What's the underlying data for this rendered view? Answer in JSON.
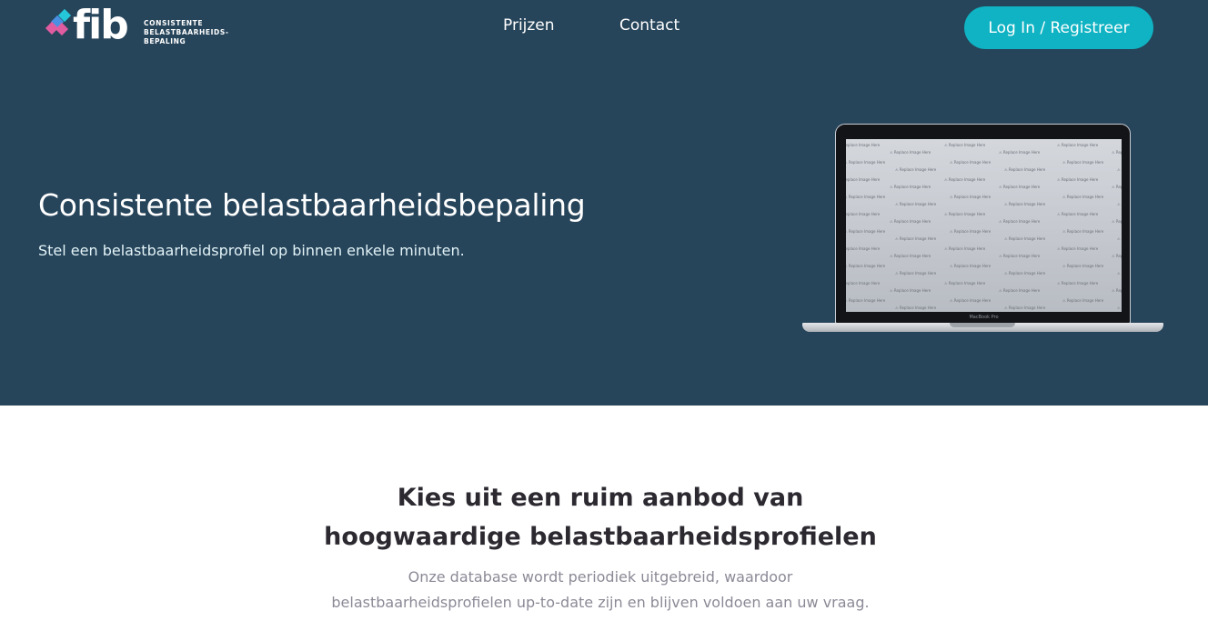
{
  "brand": {
    "logo_text": "fib",
    "tagline_lines": [
      "CONSISTENTE",
      "BELASTBAARHEIDS-",
      "BEPALING"
    ],
    "colors": {
      "pink": "#e05ca0",
      "cyan": "#26c6da",
      "blue": "#4a90e2"
    }
  },
  "nav": {
    "links": [
      "Prijzen",
      "Contact"
    ],
    "login_label": "Log In / Registreer"
  },
  "hero": {
    "title": "Consistente belastbaarheidsbepaling",
    "subtitle": "Stel een belastbaarheidsprofiel op binnen enkele minuten.",
    "laptop": {
      "model_label": "MacBook Pro",
      "placeholder_text": "Replace Image Here"
    }
  },
  "section": {
    "title_line1": "Kies uit een ruim aanbod van",
    "title_line2": "hoogwaardige belastbaarheidsprofielen",
    "description": "Onze database wordt periodiek uitgebreid, waardoor belastbaarheidsprofielen up-to-date zijn en blijven voldoen aan uw vraag."
  },
  "theme": {
    "hero_bg": "#26445a",
    "button_bg": "#0fb3c3",
    "heading_color": "#2c2930",
    "muted_text": "#8c8996"
  }
}
